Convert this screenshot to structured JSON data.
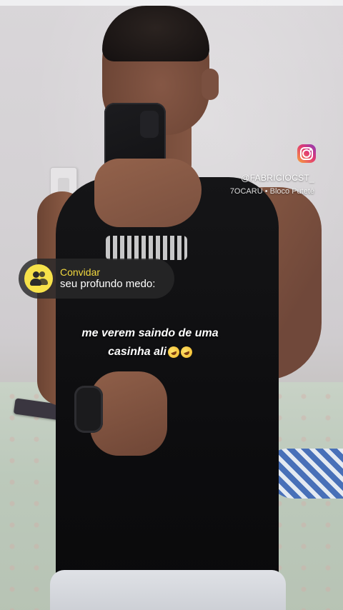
{
  "overlay": {
    "instagram_icon": "instagram-icon",
    "handle": "@FABRICIOCST_",
    "location": "7OCARU • Bloco Putetê"
  },
  "invite_sticker": {
    "icon": "group-people-icon",
    "label": "Convidar",
    "text": "seu profundo medo:"
  },
  "caption": {
    "line1": "me verem saindo de uma",
    "line2": "casinha ali",
    "emoji": "rolling-on-floor-laughing"
  },
  "colors": {
    "sticker_accent": "#f7e24a",
    "sticker_bg": "#28282a",
    "caption_text": "#ffffff"
  }
}
